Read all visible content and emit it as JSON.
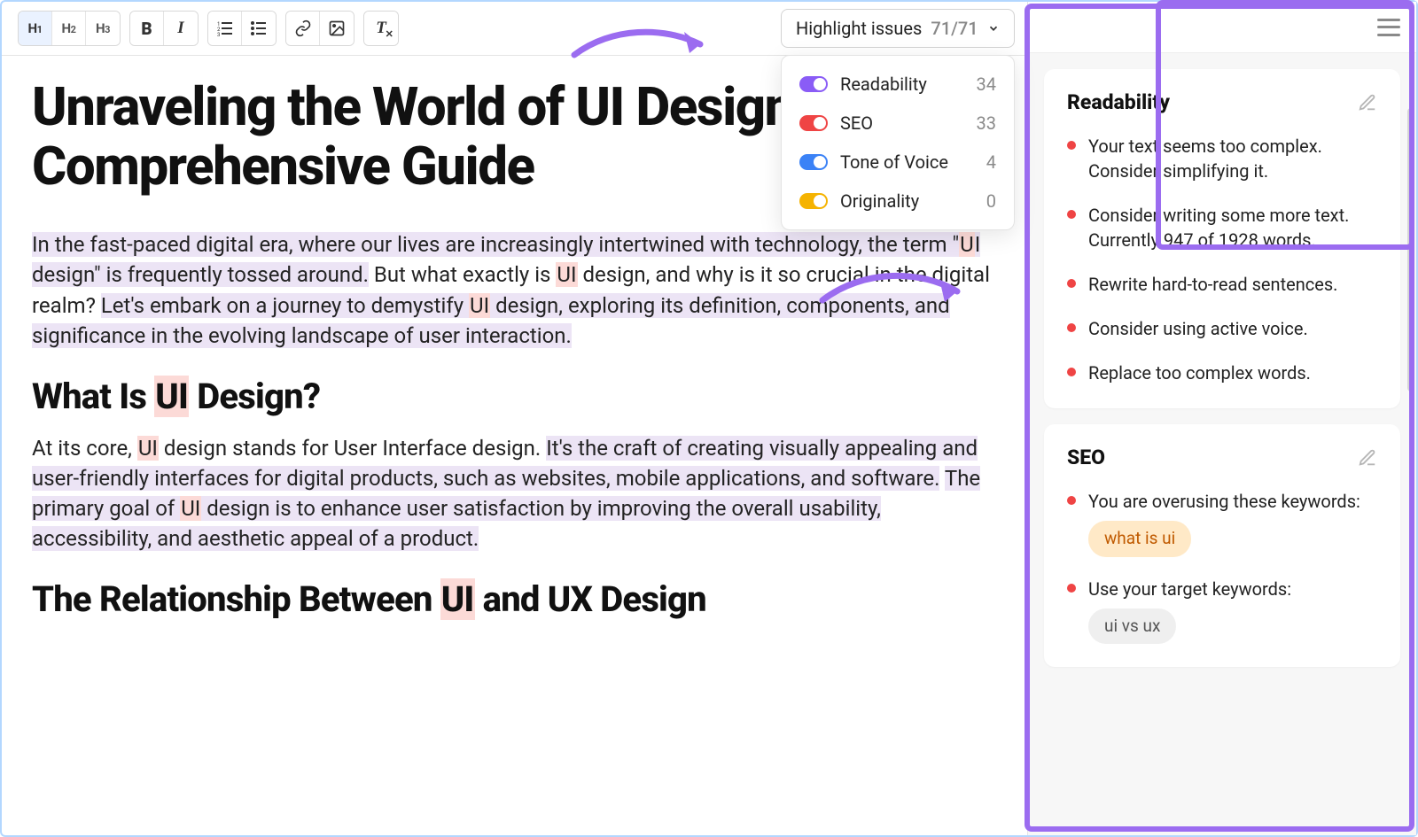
{
  "toolbar": {
    "headings": [
      "H1",
      "H2",
      "H3"
    ]
  },
  "issues_dropdown": {
    "button_label": "Highlight issues",
    "count": "71/71",
    "items": [
      {
        "label": "Readability",
        "count": 34,
        "color": "purple"
      },
      {
        "label": "SEO",
        "count": 33,
        "color": "red"
      },
      {
        "label": "Tone of Voice",
        "count": 4,
        "color": "blue"
      },
      {
        "label": "Originality",
        "count": 0,
        "color": "yellow"
      }
    ]
  },
  "document": {
    "title": "Unraveling the World of UI Design: A Comprehensive Guide",
    "para1_a": "In the fast-paced digital era, where our lives are increasingly intertwined with technology, the term \"",
    "para1_ui1": "U",
    "para1_b": "I design\" is frequently tossed around.",
    "para1_c": " But what exactly is ",
    "para1_ui2": "UI",
    "para1_d": " design, and why is it so crucial in the digital realm? ",
    "para1_e": "Let's embark on a journey to demystify ",
    "para1_ui3": "UI",
    "para1_f": " design, exploring its definition, components, and significance in the evolving landscape of user interaction.",
    "h2_1_a": "What Is ",
    "h2_1_ui": "UI",
    "h2_1_b": " Design?",
    "para2_a": "At its core, ",
    "para2_ui1": "UI",
    "para2_b": " design stands for User Interface design. ",
    "para2_c": "It's the craft of creating visually appealing and user-friendly interfaces for digital products, such as websites, mobile applications, and software.",
    "para2_d": " ",
    "para2_e": "The primary goal of ",
    "para2_ui2": "UI",
    "para2_f": " design is to enhance user satisfaction by improving the overall usability, accessibility, and aesthetic appeal of a product.",
    "h2_2_a": "The Relationship Between ",
    "h2_2_ui": "UI",
    "h2_2_b": " and UX Design"
  },
  "sidebar": {
    "readability": {
      "title": "Readability",
      "items": [
        "Your text seems too complex. Consider simplifying it.",
        "Consider writing some more text. Currently 947 of 1928 words.",
        "Rewrite hard-to-read sentences.",
        "Consider using active voice.",
        "Replace too complex words."
      ]
    },
    "seo": {
      "title": "SEO",
      "item1": "You are overusing these keywords:",
      "kw1": "what is ui",
      "item2": "Use your target keywords:",
      "kw2": "ui vs ux"
    }
  }
}
